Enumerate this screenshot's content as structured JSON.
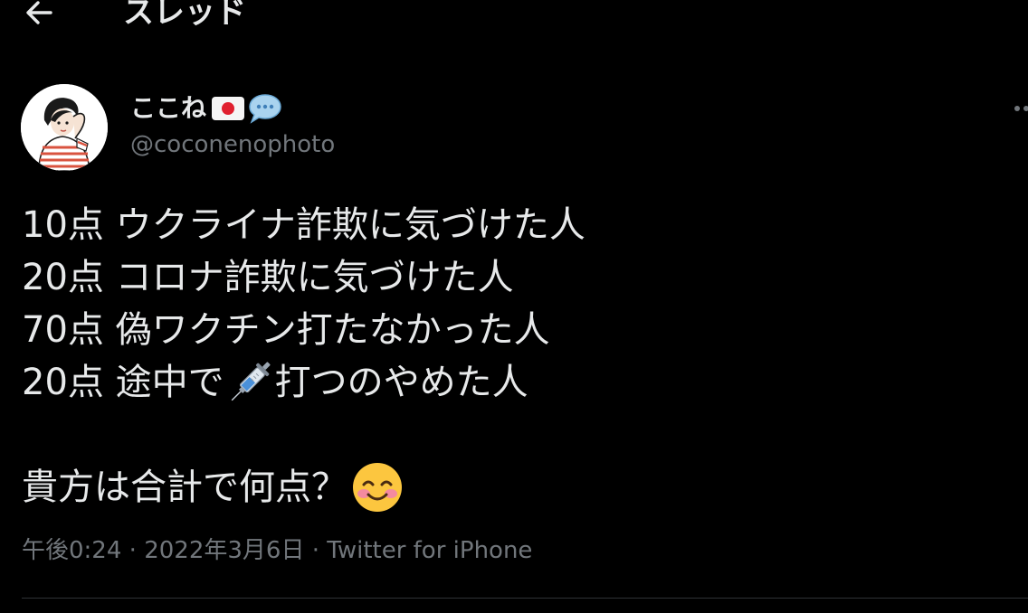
{
  "header": {
    "title": "スレッド",
    "back_icon": "back-arrow-icon"
  },
  "author": {
    "display_name": "ここね",
    "handle": "@coconenophoto",
    "name_emojis": [
      "japan-flag-icon",
      "speech-bubble-icon"
    ],
    "avatar_icon": "avatar-illustration"
  },
  "tweet": {
    "lines": [
      "10点 ウクライナ詐欺に気づけた人",
      "20点 コロナ詐欺に気づけた人",
      "70点 偽ワクチン打たなかった人"
    ],
    "line4_prefix": "20点 途中で",
    "line4_suffix": "打つのやめた人",
    "question": "貴方は合計で何点？",
    "emoji_icons": [
      "syringe-icon",
      "smiling-face-icon"
    ]
  },
  "meta": {
    "time": "午後0:24",
    "separator": "·",
    "date": "2022年3月6日",
    "source": "Twitter for iPhone"
  },
  "colors": {
    "background": "#000000",
    "primary_text": "#e7e9ea",
    "secondary_text": "#71767b",
    "divider": "#2f3336"
  }
}
